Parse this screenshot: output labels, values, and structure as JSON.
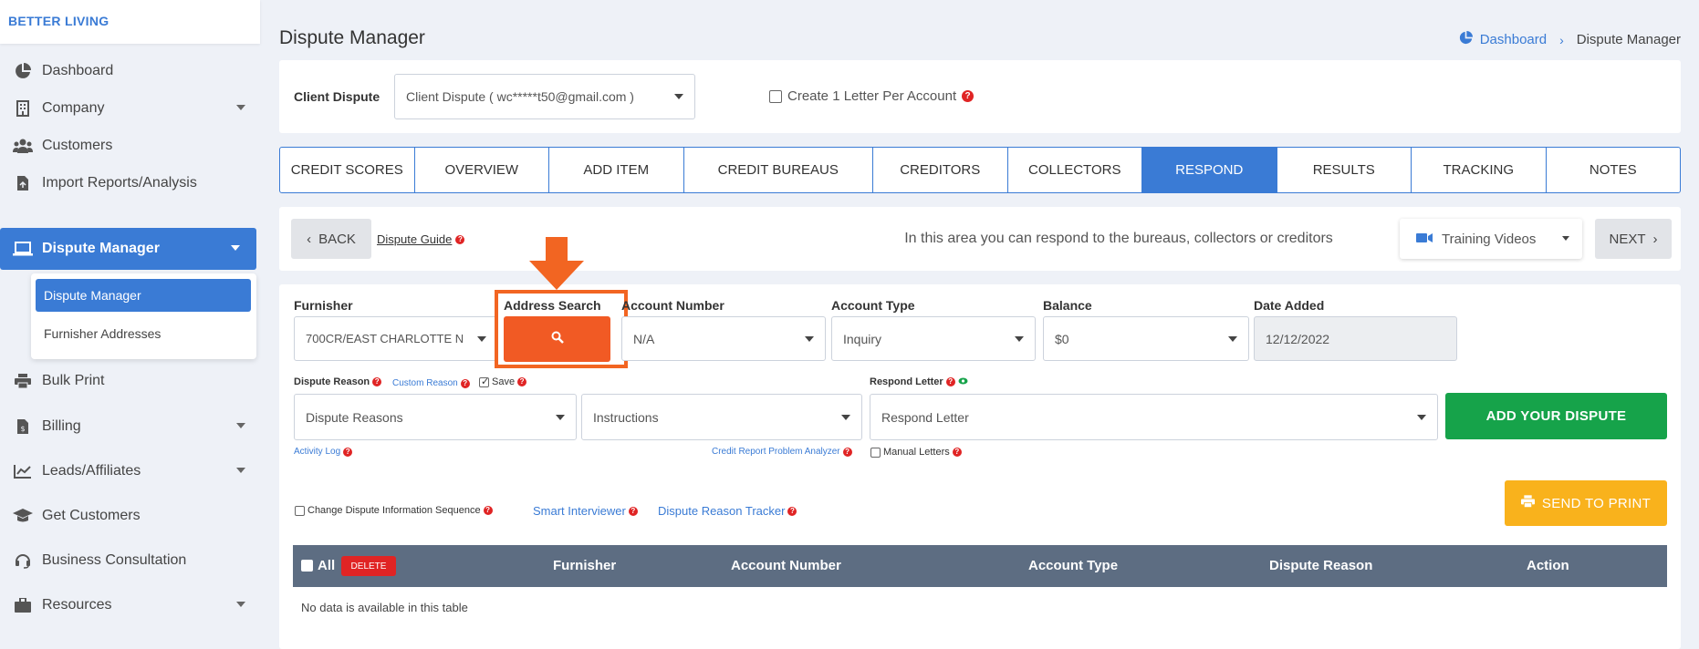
{
  "sidebar": {
    "brand": "BETTER LIVING",
    "items": [
      {
        "label": "Dashboard",
        "icon": "pie-chart-icon"
      },
      {
        "label": "Company",
        "icon": "building-icon"
      },
      {
        "label": "Customers",
        "icon": "users-icon"
      },
      {
        "label": "Import Reports/Analysis",
        "icon": "file-import-icon"
      },
      {
        "label": "Dispute Manager",
        "icon": "laptop-icon"
      },
      {
        "label": "Bulk Print",
        "icon": "print-icon"
      },
      {
        "label": "Billing",
        "icon": "invoice-icon"
      },
      {
        "label": "Leads/Affiliates",
        "icon": "chart-line-icon"
      },
      {
        "label": "Get Customers",
        "icon": "graduation-cap-icon"
      },
      {
        "label": "Business Consultation",
        "icon": "headset-icon"
      },
      {
        "label": "Resources",
        "icon": "briefcase-icon"
      }
    ],
    "submenu": [
      "Dispute Manager",
      "Furnisher Addresses"
    ]
  },
  "header": {
    "title": "Dispute Manager",
    "breadcrumb": {
      "home": "Dashboard",
      "current": "Dispute Manager"
    }
  },
  "client": {
    "label": "Client Dispute",
    "selected": "Client Dispute ( wc*****t50@gmail.com )",
    "per_account_label": "Create 1 Letter Per Account"
  },
  "tabs": [
    "CREDIT SCORES",
    "OVERVIEW",
    "ADD ITEM",
    "CREDIT BUREAUS",
    "CREDITORS",
    "COLLECTORS",
    "RESPOND",
    "RESULTS",
    "TRACKING",
    "NOTES"
  ],
  "active_tab": "RESPOND",
  "nav_bar": {
    "back": "BACK",
    "guide": "Dispute Guide",
    "info": "In this area you can respond to the bureaus, collectors or creditors",
    "videos": "Training Videos",
    "next": "NEXT"
  },
  "form": {
    "furnisher_label": "Furnisher",
    "furnisher_value": "700CR/EAST CHARLOTTE N",
    "address_search_label": "Address Search",
    "account_number_label": "Account Number",
    "account_number_value": "N/A",
    "account_type_label": "Account Type",
    "account_type_value": "Inquiry",
    "balance_label": "Balance",
    "balance_value": "$0",
    "date_added_label": "Date Added",
    "date_added_value": "12/12/2022",
    "dispute_reason_label": "Dispute Reason",
    "custom_reason": "Custom Reason",
    "save_label": "Save",
    "respond_letter_label": "Respond Letter",
    "dispute_reasons_value": "Dispute Reasons",
    "instructions_value": "Instructions",
    "respond_letter_value": "Respond Letter",
    "add_dispute": "ADD YOUR DISPUTE",
    "activity_log": "Activity Log",
    "credit_analyzer": "Credit Report Problem Analyzer",
    "manual_letters": "Manual Letters",
    "change_sequence": "Change Dispute Information Sequence",
    "smart_interviewer": "Smart Interviewer",
    "reason_tracker": "Dispute Reason Tracker",
    "send_to_print": "SEND TO PRINT"
  },
  "table": {
    "all_label": "All",
    "delete_label": "DELETE",
    "columns": [
      "Furnisher",
      "Account Number",
      "Account Type",
      "Dispute Reason",
      "Action"
    ],
    "empty": "No data is available in this table"
  },
  "colors": {
    "primary": "#3a7bd5",
    "highlight": "#f26522",
    "success": "#16a34a",
    "warning": "#f9b21c",
    "danger": "#e02424",
    "table_header": "#5d6d82"
  }
}
